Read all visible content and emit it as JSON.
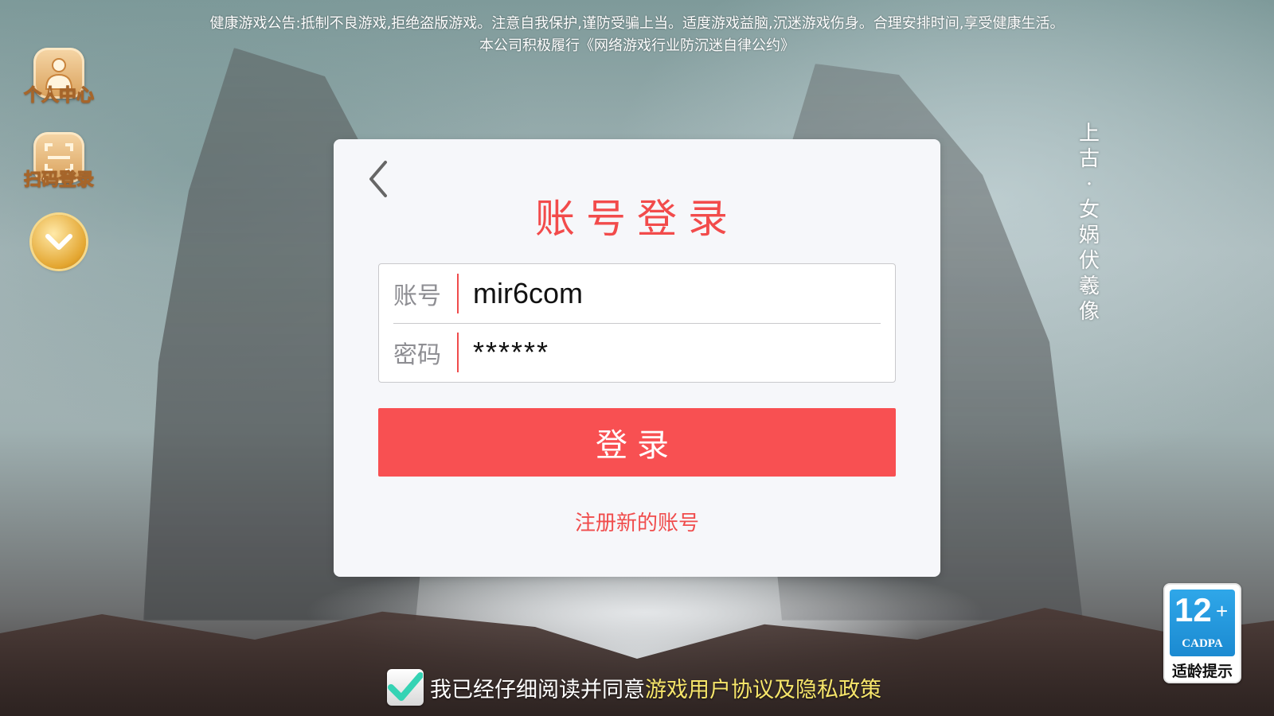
{
  "notice": {
    "line1": "健康游戏公告:抵制不良游戏,拒绝盗版游戏。注意自我保护,谨防受骗上当。适度游戏益脑,沉迷游戏伤身。合理安排时间,享受健康生活。",
    "line2": "本公司积极履行《网络游戏行业防沉迷自律公约》"
  },
  "sidebar": {
    "profile_label": "个人中心",
    "qr_login_label": "扫码登录",
    "expand_icon": "chevron-down-icon"
  },
  "vertical_title": [
    "上",
    "古",
    "·",
    "女",
    "娲",
    "伏",
    "羲",
    "像"
  ],
  "dialog": {
    "title": "账号登录",
    "account_label": "账号",
    "account_value": "mir6com",
    "password_label": "密码",
    "password_value": "******",
    "login_button": "登录",
    "register_link": "注册新的账号"
  },
  "agreement": {
    "checked": true,
    "text": "我已经仔细阅读并同意",
    "link": "游戏用户协议及隐私政策"
  },
  "age_rating": {
    "number": "12",
    "plus": "+",
    "org": "CADPA",
    "caption": "适龄提示"
  },
  "colors": {
    "accent": "#f85052",
    "title": "#f24b4b",
    "link_yellow": "#f6e56a",
    "badge_blue": "#1b8ad1"
  }
}
